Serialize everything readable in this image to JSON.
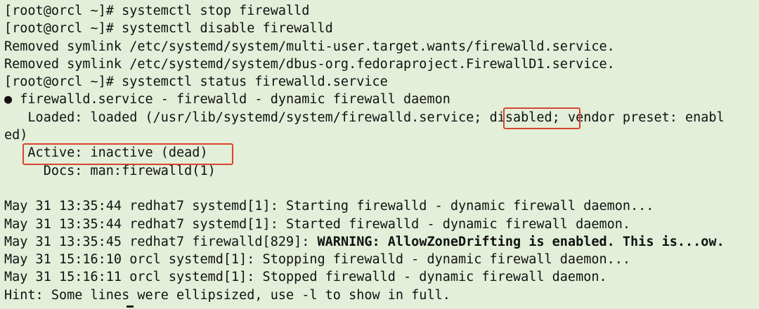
{
  "colors": {
    "background": "#e3efd9",
    "text": "#111111",
    "highlight": "#d9442e"
  },
  "lines": [
    {
      "text": "[root@orcl ~]# systemctl stop firewalld"
    },
    {
      "text": "[root@orcl ~]# systemctl disable firewalld"
    },
    {
      "text": "Removed symlink /etc/systemd/system/multi-user.target.wants/firewalld.service."
    },
    {
      "text": "Removed symlink /etc/systemd/system/dbus-org.fedoraproject.FirewallD1.service."
    },
    {
      "text": "[root@orcl ~]# systemctl status firewalld.service"
    },
    {
      "text": "● firewalld.service - firewalld - dynamic firewall daemon"
    },
    {
      "before": "   Loaded: loaded (/usr/lib/systemd/system/firewalld.service; ",
      "highlight": "disabled",
      "after": "; vendor preset: enabl"
    },
    {
      "text": "ed)"
    },
    {
      "text": "   Active: inactive (dead)"
    },
    {
      "text": "     Docs: man:firewalld(1)"
    },
    {
      "text": ""
    },
    {
      "text": "May 31 13:35:44 redhat7 systemd[1]: Starting firewalld - dynamic firewall daemon..."
    },
    {
      "text": "May 31 13:35:44 redhat7 systemd[1]: Started firewalld - dynamic firewall daemon."
    },
    {
      "before": "May 31 13:35:45 redhat7 firewalld[829]: ",
      "bold": "WARNING: AllowZoneDrifting is enabled. This is...ow."
    },
    {
      "text": "May 31 15:16:10 orcl systemd[1]: Stopping firewalld - dynamic firewall daemon..."
    },
    {
      "text": "May 31 15:16:11 orcl systemd[1]: Stopped firewalld - dynamic firewall daemon."
    },
    {
      "text": "Hint: Some lines were ellipsized, use -l to show in full."
    }
  ]
}
